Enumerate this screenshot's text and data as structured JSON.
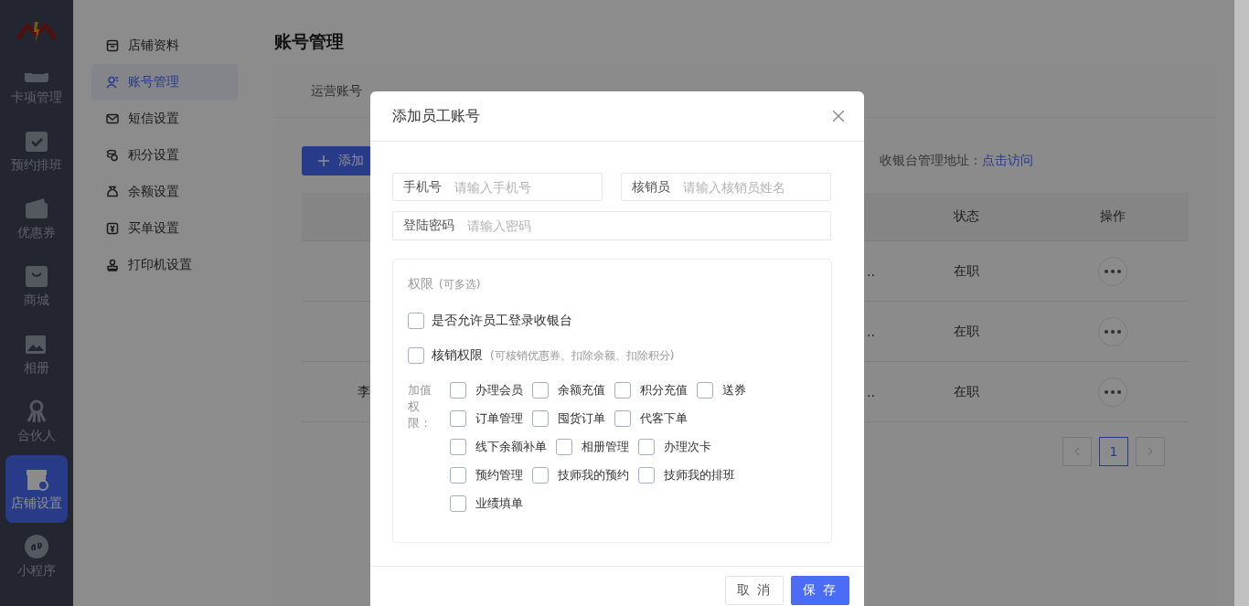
{
  "sidebar": {
    "items": [
      {
        "label": "卡项管理",
        "selected": false
      },
      {
        "label": "预约排班",
        "selected": false
      },
      {
        "label": "优惠券",
        "selected": false
      },
      {
        "label": "商城",
        "selected": false
      },
      {
        "label": "相册",
        "selected": false
      },
      {
        "label": "合伙人",
        "selected": false
      },
      {
        "label": "店铺设置",
        "selected": true
      },
      {
        "label": "小程序",
        "selected": false
      }
    ]
  },
  "subnav": {
    "items": [
      {
        "label": "店铺资料",
        "selected": false
      },
      {
        "label": "账号管理",
        "selected": true
      },
      {
        "label": "短信设置",
        "selected": false
      },
      {
        "label": "积分设置",
        "selected": false
      },
      {
        "label": "余额设置",
        "selected": false
      },
      {
        "label": "买单设置",
        "selected": false
      },
      {
        "label": "打印机设置",
        "selected": false
      }
    ]
  },
  "page": {
    "title": "账号管理",
    "tabs": [
      {
        "label": "运营账号",
        "selected": false
      }
    ],
    "add_button": "添加",
    "cashier_label": "收银台管理地址：",
    "cashier_link": "点击访问",
    "table": {
      "columns": [
        "状态",
        "操作"
      ],
      "rows": [
        {
          "column_2": "..",
          "status": "在职"
        },
        {
          "column_2": "..",
          "status": "在职"
        },
        {
          "column_1": "李",
          "column_2": "..",
          "status": "在职"
        }
      ]
    },
    "pagination": {
      "pages": [
        {
          "label": "1",
          "selected": true
        }
      ]
    }
  },
  "dialog": {
    "title": "添加员工账号",
    "fields": [
      {
        "label": "手机号",
        "placeholder": "请输入手机号"
      },
      {
        "label": "核销员",
        "placeholder": "请输入核销员姓名"
      },
      {
        "label": "登陆密码",
        "placeholder": "请输入密码"
      }
    ],
    "permissions": {
      "title": "权限",
      "hint": "(可多选)",
      "options": [
        {
          "label": "是否允许员工登录收银台",
          "checked": false
        },
        {
          "label": "核销权限",
          "note": "(可核销优惠券、扣除余额、扣除积分)",
          "checked": false
        }
      ],
      "extra_label": "加值权限：",
      "extra_rows": [
        [
          {
            "label": "办理会员",
            "checked": false
          },
          {
            "label": "余额充值",
            "checked": false
          },
          {
            "label": "积分充值",
            "checked": false
          },
          {
            "label": "送券",
            "checked": false
          }
        ],
        [
          {
            "label": "订单管理",
            "checked": false
          },
          {
            "label": "囤货订单",
            "checked": false
          },
          {
            "label": "代客下单",
            "checked": false
          }
        ],
        [
          {
            "label": "线下余额补单",
            "checked": false
          },
          {
            "label": "相册管理",
            "checked": false
          },
          {
            "label": "办理次卡",
            "checked": false
          }
        ],
        [
          {
            "label": "预约管理",
            "checked": false
          },
          {
            "label": "技师我的预约",
            "checked": false
          },
          {
            "label": "技师我的排班",
            "checked": false
          }
        ],
        [
          {
            "label": "业绩填单",
            "checked": false
          }
        ]
      ]
    },
    "buttons": [
      {
        "label": "取 消",
        "kind": "secondary"
      },
      {
        "label": "保 存",
        "kind": "primary"
      }
    ]
  }
}
